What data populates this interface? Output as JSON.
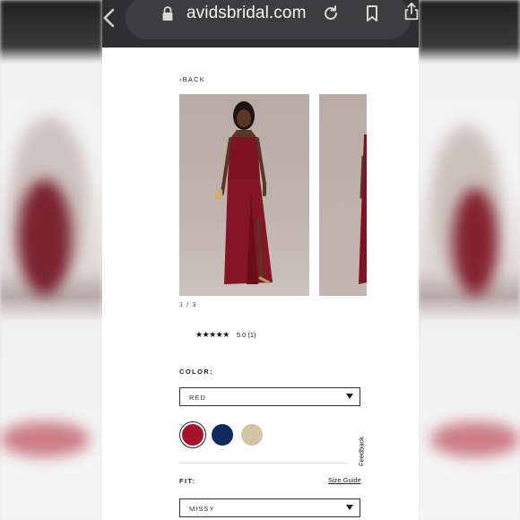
{
  "browser": {
    "url": "avidsbridal.com"
  },
  "page": {
    "back_label": "BACK",
    "pager": "1 / 3",
    "rating": {
      "stars": "★★★★★",
      "text": "5.0 (1)"
    },
    "color_label": "COLOR:",
    "color_value": "RED",
    "swatches": [
      {
        "name": "red",
        "color": "#a3132b",
        "selected": true
      },
      {
        "name": "navy",
        "color": "#102a5e",
        "selected": false
      },
      {
        "name": "champagne",
        "color": "#d2c4a5",
        "selected": false
      }
    ],
    "feedback_label": "Feedback",
    "fit_label": "FIT:",
    "size_guide_label": "Size Guide",
    "fit_value": "MISSY"
  }
}
